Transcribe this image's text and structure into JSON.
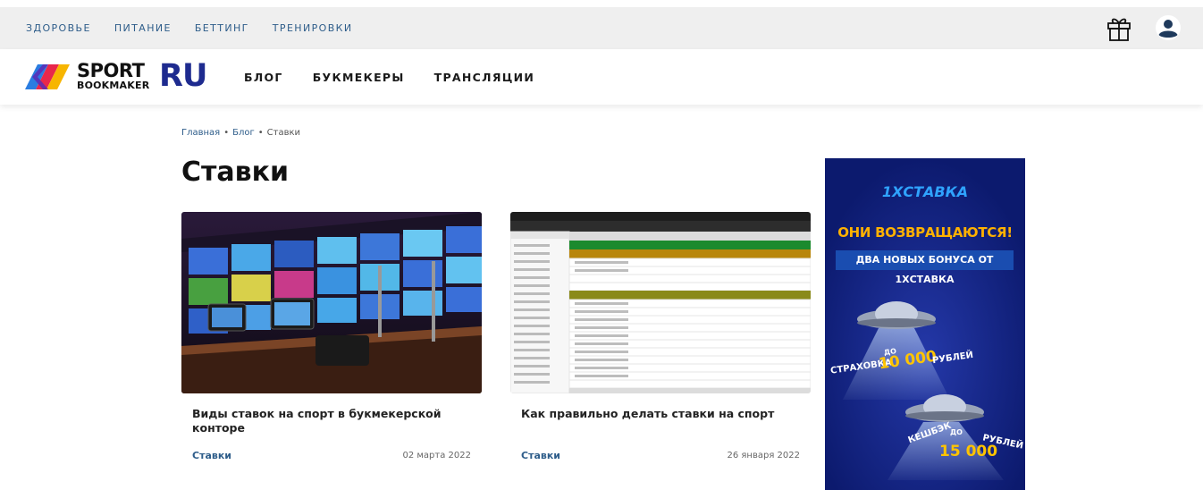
{
  "topbar": {
    "links": [
      "ЗДОРОВЬЕ",
      "ПИТАНИЕ",
      "БЕТТИНГ",
      "ТРЕНИРОВКИ"
    ]
  },
  "logo": {
    "line1": "SPORT",
    "line2": "BOOKMAKER",
    "suffix": "RU"
  },
  "nav": {
    "items": [
      "БЛОГ",
      "БУКМЕКЕРЫ",
      "ТРАНСЛЯЦИИ"
    ]
  },
  "breadcrumb": {
    "home": "Главная",
    "sep": "•",
    "blog": "Блог",
    "current": "Ставки"
  },
  "page": {
    "title": "Ставки"
  },
  "articles": [
    {
      "title": "Виды ставок на спорт в букмекерской конторе",
      "category": "Ставки",
      "date": "02 марта 2022"
    },
    {
      "title": "Как правильно делать ставки на спорт",
      "category": "Ставки",
      "date": "26 января 2022"
    }
  ],
  "ad": {
    "brand": "1XСТАВКА",
    "headline": "ОНИ ВОЗВРАЩАЮТСЯ!",
    "sub": "ДВА НОВЫХ БОНУСА ОТ 1XСТАВКА",
    "offer1_label": "СТРАХОВКА",
    "offer1_prep": "ДО",
    "offer1_amount": "10 000",
    "offer1_unit": "РУБЛЕЙ",
    "offer2_label": "КЕШБЭК",
    "offer2_prep": "ДО",
    "offer2_amount": "15 000",
    "offer2_unit": "РУБЛЕЙ"
  },
  "colors": {
    "accent": "#2e5d8a",
    "brand_ru": "#1e2b8f",
    "ad_bg": "#0c1a6e",
    "ad_yellow": "#ffb100"
  }
}
